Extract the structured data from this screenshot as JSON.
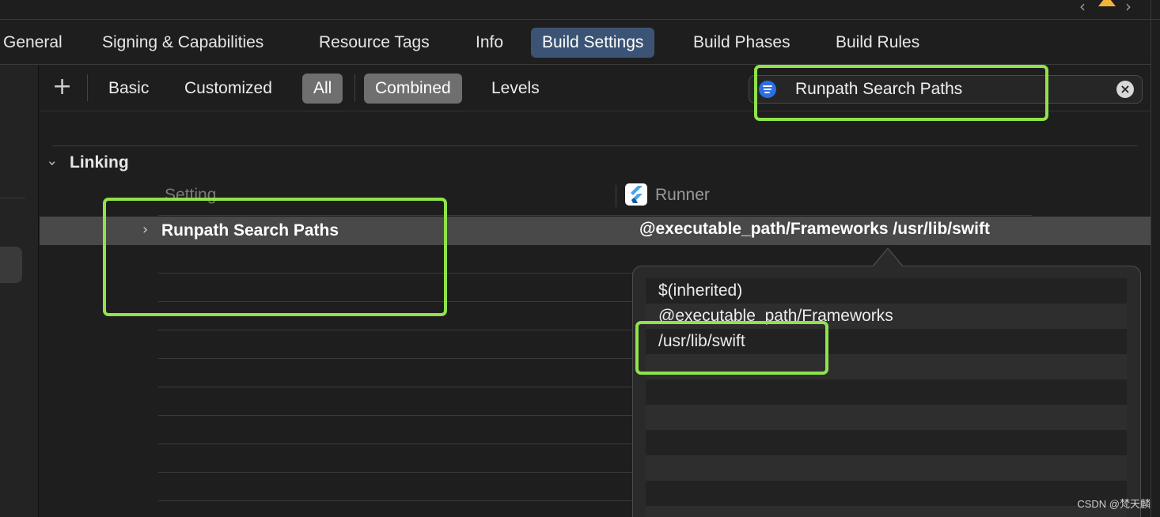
{
  "tabs": [
    {
      "label": "General",
      "selected": false
    },
    {
      "label": "Signing & Capabilities",
      "selected": false
    },
    {
      "label": "Resource Tags",
      "selected": false
    },
    {
      "label": "Info",
      "selected": false
    },
    {
      "label": "Build Settings",
      "selected": true
    },
    {
      "label": "Build Phases",
      "selected": false
    },
    {
      "label": "Build Rules",
      "selected": false
    }
  ],
  "filterbar": {
    "add_icon": "plus-icon",
    "scope": [
      {
        "label": "Basic",
        "selected": false
      },
      {
        "label": "Customized",
        "selected": false
      },
      {
        "label": "All",
        "selected": true
      }
    ],
    "view": [
      {
        "label": "Combined",
        "selected": true
      },
      {
        "label": "Levels",
        "selected": false
      }
    ],
    "search": {
      "value": "Runpath Search Paths",
      "filter_icon": "filter-icon",
      "clear_icon": "clear-icon"
    }
  },
  "section": {
    "title": "Linking"
  },
  "columns": {
    "setting": "Setting",
    "target": "Runner",
    "target_icon": "flutter-icon"
  },
  "setting_row": {
    "name": "Runpath Search Paths",
    "value": "@executable_path/Frameworks /usr/lib/swift"
  },
  "popover": {
    "items": [
      "$(inherited)",
      "@executable_path/Frameworks",
      "/usr/lib/swift"
    ]
  },
  "watermark": "CSDN @梵天麟",
  "colors": {
    "accent_tab": "#3b5375",
    "highlight": "#8fe34a",
    "search_filter": "#2b6ee6",
    "warning": "#f2b53a"
  }
}
